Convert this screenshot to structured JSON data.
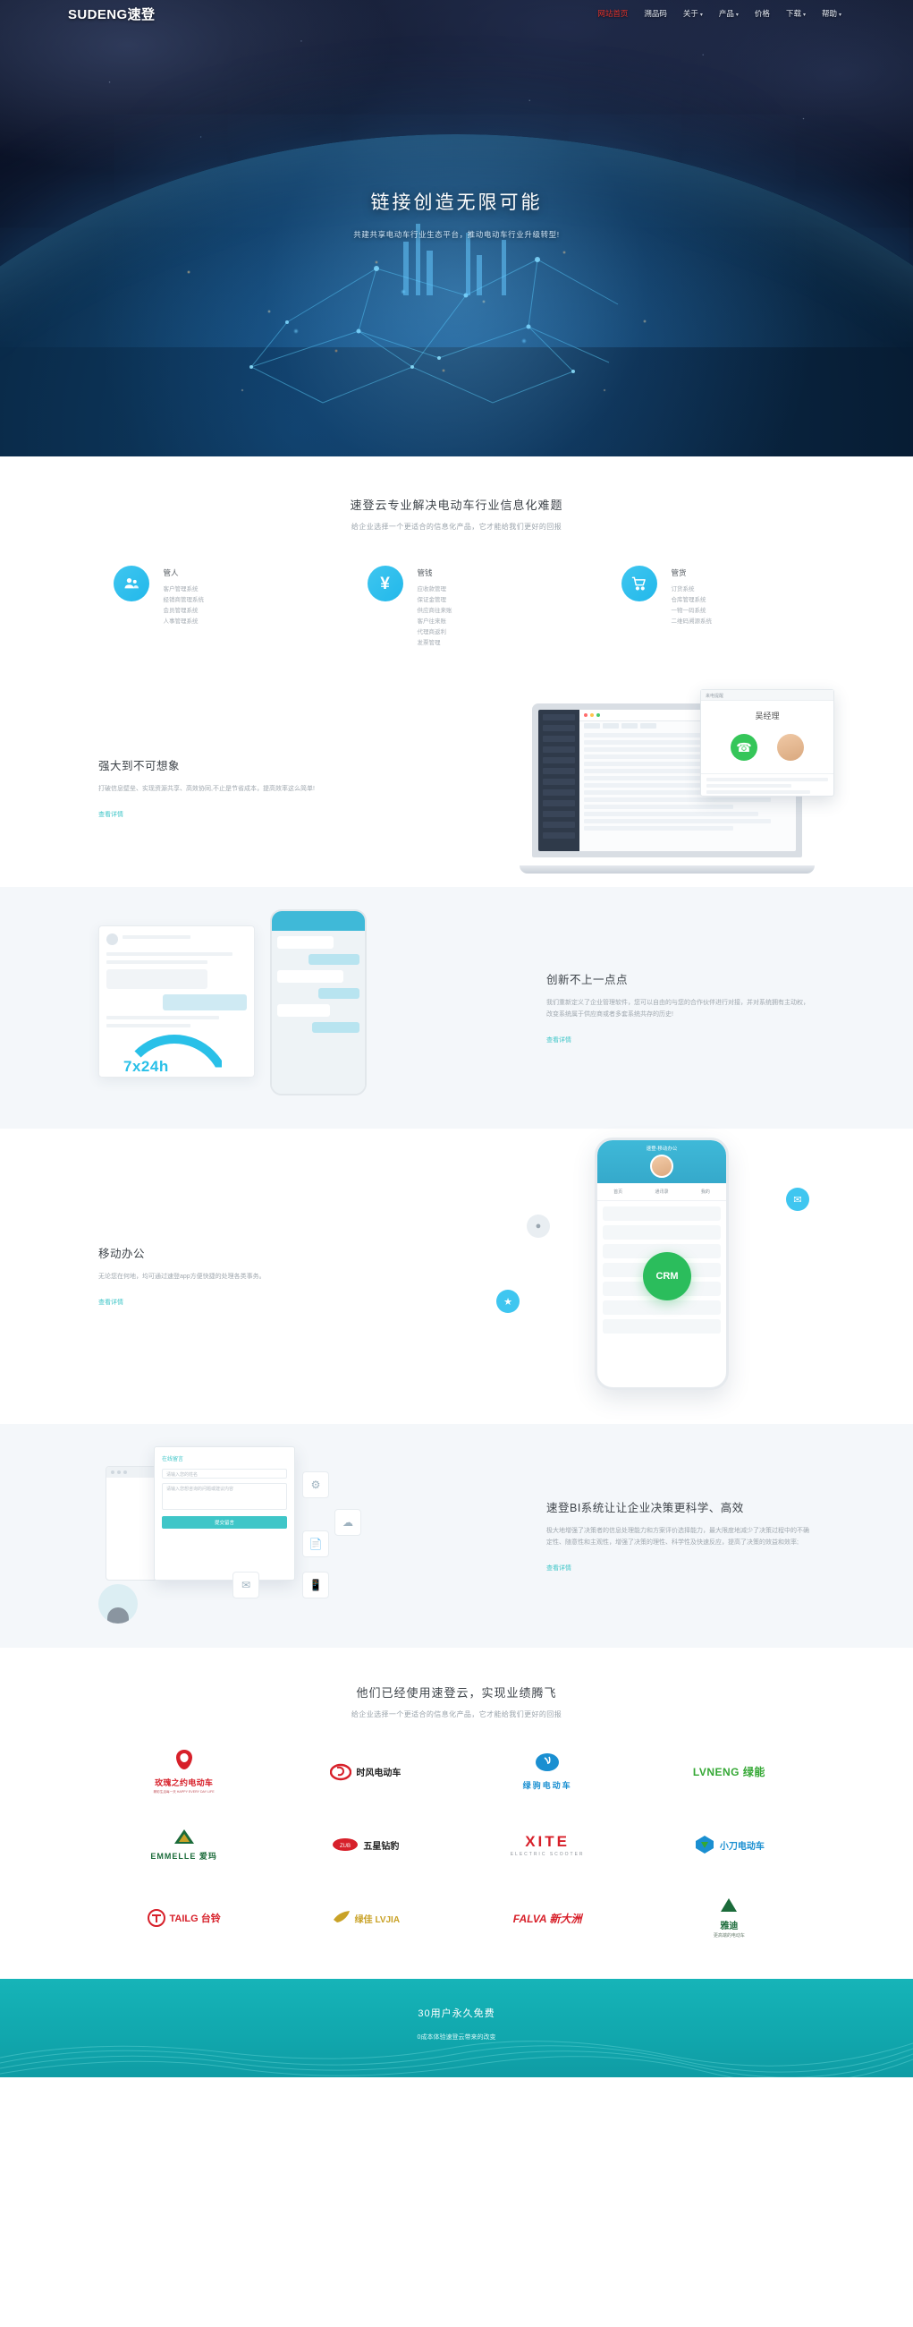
{
  "header": {
    "logo": "SUDENG速登",
    "nav": [
      {
        "label": "网站首页",
        "active": true,
        "caret": ""
      },
      {
        "label": "溯品码",
        "active": false,
        "caret": ""
      },
      {
        "label": "关于",
        "active": false,
        "caret": "▾"
      },
      {
        "label": "产品",
        "active": false,
        "caret": "▾"
      },
      {
        "label": "价格",
        "active": false,
        "caret": ""
      },
      {
        "label": "下载",
        "active": false,
        "caret": "▾"
      },
      {
        "label": "帮助",
        "active": false,
        "caret": "▾"
      }
    ]
  },
  "hero": {
    "title": "链接创造无限可能",
    "subtitle": "共建共享电动车行业生态平台，推动电动车行业升级转型!"
  },
  "solutions": {
    "title": "速登云专业解决电动车行业信息化难题",
    "subtitle": "给企业选择一个更适合的信息化产品，它才能给我们更好的回报",
    "items": [
      {
        "icon": "people-icon",
        "name": "管人",
        "list": [
          "客户管理系统",
          "经销商管理系统",
          "会员管理系统",
          "人事管理系统"
        ]
      },
      {
        "icon": "yuan-icon",
        "name": "管钱",
        "list": [
          "应收款管理",
          "保证金管理",
          "供应商往来账",
          "客户往来账",
          "代理商返利",
          "发票管理"
        ]
      },
      {
        "icon": "cart-icon",
        "name": "管货",
        "list": [
          "订货系统",
          "仓库管理系统",
          "一物一码系统",
          "二维码溯源系统"
        ]
      }
    ]
  },
  "powerful": {
    "title": "强大到不可想象",
    "text": "打破信息壁垒、实现资源共享、高效协同,不止是节省成本，提高效率这么简单!",
    "link": "查看详情",
    "call_window": {
      "titlebar": "来电提醒",
      "caller": "吴经理",
      "answer_icon": "phone-icon"
    }
  },
  "innovation": {
    "title": "创新不上一点点",
    "text": "我们重新定义了企业管理软件，您可以自由的与您的合作伙伴进行对接，并对系统拥有主动权，改变系统属于供应商或者多套系统共存的历史!",
    "link": "查看详情",
    "badge": "7x24h"
  },
  "mobile": {
    "title": "移动办公",
    "text": "无论您在何地，均可通过速登app方便快捷的处理各类事务。",
    "link": "查看详情",
    "app_name": "速登·移动办公",
    "crm_label": "CRM",
    "tabs": [
      "首页",
      "通讯录",
      "我的"
    ],
    "float_icons": [
      "chat-icon",
      "bell-icon",
      "user-icon"
    ]
  },
  "bi": {
    "title": "速登BI系统让让企业决策更科学、高效",
    "text": "极大地增强了决策者的信息处理能力和方案评价选择能力，最大限度地减少了决策过程中的不确定性、随意性和主观性，增强了决策的理性、科学性及快速反应，提高了决策的效益和效率;",
    "link": "查看详情",
    "form": {
      "title": "在线留言",
      "field_name_placeholder": "请输入您的姓名",
      "field_msg_placeholder": "请输入您想咨询的问题或建议内容",
      "submit": "提交留言"
    },
    "side_icons": [
      "settings-gear-icon",
      "cloud-icon",
      "document-icon",
      "mail-icon",
      "mobile-icon"
    ]
  },
  "clients": {
    "title": "他们已经使用速登云，实现业绩腾飞",
    "subtitle": "给企业选择一个更适合的信息化产品，它才能给我们更好的回报",
    "logos": [
      {
        "name": "玫瑰之约电动车",
        "sub": "精彩生活每一天  HAPPY EVERY DAY LIFE",
        "color": "#d7202a"
      },
      {
        "name": "时风电动车",
        "sub": "",
        "color": "#d7202a"
      },
      {
        "name": "绿驹电动车",
        "sub": "",
        "color": "#1a8fd1"
      },
      {
        "name": "LVNENG 绿能",
        "sub": "",
        "color": "#35a835"
      },
      {
        "name": "EMMELLE 爱玛",
        "sub": "",
        "color": "#1b6b3a"
      },
      {
        "name": "五星钻豹",
        "sub": "ZUB",
        "color": "#d7202a"
      },
      {
        "name": "XITE",
        "sub": "ELECTRIC SCOOTER",
        "color": "#d7202a"
      },
      {
        "name": "小刀电动车",
        "sub": "",
        "color": "#1a8fd1"
      },
      {
        "name": "TAILG 台铃",
        "sub": "",
        "color": "#d7202a"
      },
      {
        "name": "绿佳 LVJIA",
        "sub": "",
        "color": "#c9a227"
      },
      {
        "name": "FALVA 新大洲",
        "sub": "",
        "color": "#d7202a"
      },
      {
        "name": "雅迪",
        "sub": "更高端的电动车",
        "color": "#1b6b3a"
      }
    ]
  },
  "footer": {
    "title": "30用户永久免费",
    "subtitle": "0成本体验速登云带来的改变"
  }
}
